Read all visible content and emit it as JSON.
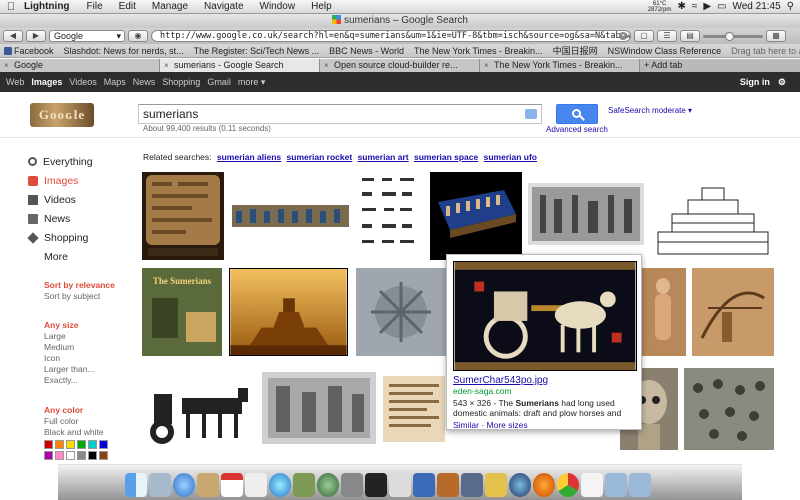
{
  "menubar": {
    "app_name": "Lightning",
    "items": [
      "File",
      "Edit",
      "Manage",
      "Navigate",
      "Window",
      "Help"
    ],
    "temp": "61°C",
    "rpm": "2872rpm",
    "clock": "Wed 21:45"
  },
  "window": {
    "title": "sumerians – Google Search"
  },
  "toolbar": {
    "back": "◀",
    "forward": "▶",
    "engine": "Google",
    "url": "http://www.google.co.uk/search?hl=en&q=sumerians&um=1&ie=UTF-8&tbm=isch&source=og&sa=N&tab=wi",
    "bookmark_hint": "Drag tab here to add as a bookmark"
  },
  "bookmarks": [
    "Facebook",
    "Slashdot: News for nerds, st...",
    "The Register: Sci/Tech News ...",
    "BBC News - World",
    "The New York Times - Breakin...",
    "中国日报网",
    "NSWindow Class Reference"
  ],
  "tabs": [
    "Google",
    "sumerians - Google Search",
    "Open source cloud-builder re...",
    "The New York Times - Breakin..."
  ],
  "add_tab": "+ Add tab",
  "gbar": {
    "links": [
      "Web",
      "Images",
      "Videos",
      "Maps",
      "News",
      "Shopping",
      "Gmail",
      "more ▾"
    ],
    "sign_in": "Sign in"
  },
  "search": {
    "query": "sumerians",
    "results_stats": "About 99,400 results (0.11 seconds)",
    "advanced": "Advanced search",
    "safesearch": "SafeSearch moderate ▾"
  },
  "leftnav": {
    "items": [
      "Everything",
      "Images",
      "Videos",
      "News",
      "Shopping",
      "More"
    ],
    "sort_heading": "Sort by relevance",
    "sort_subject": "Sort by subject",
    "size_heading": "Any size",
    "sizes": [
      "Large",
      "Medium",
      "Icon",
      "Larger than...",
      "Exactly..."
    ],
    "color_heading": "Any color",
    "colors": [
      "Full color",
      "Black and white"
    ],
    "swatches": [
      "#cc0000",
      "#ff8800",
      "#ffdd00",
      "#00aa00",
      "#00cccc",
      "#0000dd",
      "#aa00aa",
      "#ff88cc",
      "#ffffff",
      "#888888",
      "#000000",
      "#8b4513"
    ]
  },
  "related": {
    "label": "Related searches:",
    "links": [
      "sumerian aliens",
      "sumerian rocket",
      "sumerian art",
      "sumerian space",
      "sumerian ufo"
    ]
  },
  "hover": {
    "filename": "SumerChar543po.jpg",
    "domain": "eden-saga.com",
    "dims": "543 × 326 - The ",
    "bold": "Sumerians",
    "desc_rest": " had long used domestic animals: draft and plow horses and",
    "similar": "Similar",
    "sep": " - ",
    "more_sizes": "More sizes"
  },
  "thumb_book_title": "The Sumerians"
}
